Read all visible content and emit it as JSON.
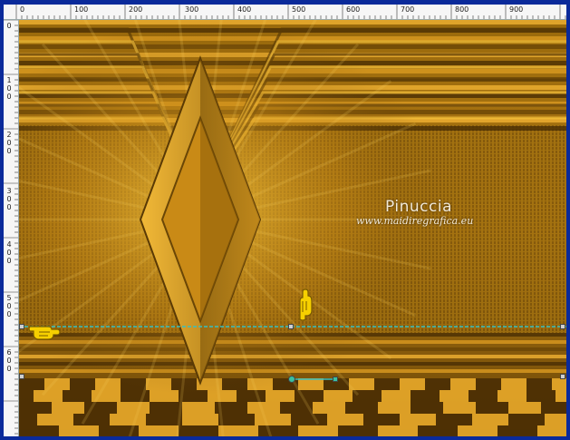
{
  "ruler": {
    "top_labels": [
      "0",
      "100",
      "200",
      "300",
      "400",
      "500",
      "600",
      "700",
      "800",
      "900"
    ],
    "left_labels": [
      "0",
      "1\n0\n0",
      "2\n0\n0",
      "3\n0\n0",
      "4\n0\n0",
      "5\n0\n0",
      "6\n0\n0"
    ]
  },
  "watermark": {
    "name": "Pinuccia",
    "url": "www.maidiregrafica.eu"
  },
  "colors": {
    "gold": "#e2a11c",
    "dark_gold": "#5a3a05",
    "bright_gold": "#f6c23c",
    "selection_line": "#38c0c0"
  },
  "icons": {
    "pointer_left": "pointing-hand-right-icon",
    "pointer_up": "pointing-hand-up-icon"
  }
}
